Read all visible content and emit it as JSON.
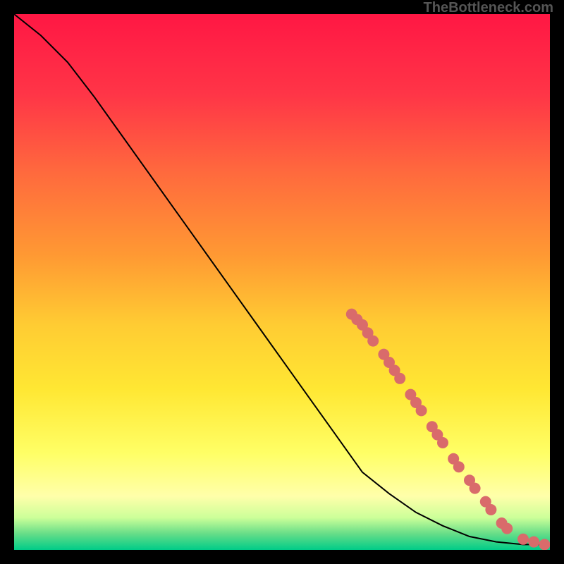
{
  "watermark": "TheBottleneck.com",
  "chart_data": {
    "type": "line",
    "title": "",
    "xlabel": "",
    "ylabel": "",
    "xlim": [
      0,
      100
    ],
    "ylim": [
      0,
      100
    ],
    "line_path": [
      {
        "x": 0,
        "y": 100
      },
      {
        "x": 5,
        "y": 96
      },
      {
        "x": 10,
        "y": 91
      },
      {
        "x": 15,
        "y": 84.5
      },
      {
        "x": 20,
        "y": 77.5
      },
      {
        "x": 25,
        "y": 70.5
      },
      {
        "x": 30,
        "y": 63.5
      },
      {
        "x": 35,
        "y": 56.5
      },
      {
        "x": 40,
        "y": 49.5
      },
      {
        "x": 45,
        "y": 42.5
      },
      {
        "x": 50,
        "y": 35.5
      },
      {
        "x": 55,
        "y": 28.5
      },
      {
        "x": 60,
        "y": 21.5
      },
      {
        "x": 65,
        "y": 14.5
      },
      {
        "x": 70,
        "y": 10.5
      },
      {
        "x": 75,
        "y": 7
      },
      {
        "x": 80,
        "y": 4.5
      },
      {
        "x": 85,
        "y": 2.5
      },
      {
        "x": 90,
        "y": 1.5
      },
      {
        "x": 95,
        "y": 1
      },
      {
        "x": 100,
        "y": 1
      }
    ],
    "scatter_points": [
      {
        "x": 63,
        "y": 44
      },
      {
        "x": 64,
        "y": 43
      },
      {
        "x": 65,
        "y": 42
      },
      {
        "x": 66,
        "y": 40.5
      },
      {
        "x": 67,
        "y": 39
      },
      {
        "x": 69,
        "y": 36.5
      },
      {
        "x": 70,
        "y": 35
      },
      {
        "x": 71,
        "y": 33.5
      },
      {
        "x": 72,
        "y": 32
      },
      {
        "x": 74,
        "y": 29
      },
      {
        "x": 75,
        "y": 27.5
      },
      {
        "x": 76,
        "y": 26
      },
      {
        "x": 78,
        "y": 23
      },
      {
        "x": 79,
        "y": 21.5
      },
      {
        "x": 80,
        "y": 20
      },
      {
        "x": 82,
        "y": 17
      },
      {
        "x": 83,
        "y": 15.5
      },
      {
        "x": 85,
        "y": 13
      },
      {
        "x": 86,
        "y": 11.5
      },
      {
        "x": 88,
        "y": 9
      },
      {
        "x": 89,
        "y": 7.5
      },
      {
        "x": 91,
        "y": 5
      },
      {
        "x": 92,
        "y": 4
      },
      {
        "x": 95,
        "y": 2
      },
      {
        "x": 97,
        "y": 1.5
      },
      {
        "x": 99,
        "y": 1
      }
    ],
    "gradient_stops": [
      {
        "offset": 0,
        "color": "#ff1744"
      },
      {
        "offset": 15,
        "color": "#ff3547"
      },
      {
        "offset": 30,
        "color": "#ff6b3d"
      },
      {
        "offset": 45,
        "color": "#ff9933"
      },
      {
        "offset": 58,
        "color": "#ffcc33"
      },
      {
        "offset": 70,
        "color": "#ffe733"
      },
      {
        "offset": 82,
        "color": "#ffff66"
      },
      {
        "offset": 90,
        "color": "#ffffaa"
      },
      {
        "offset": 94,
        "color": "#ccff99"
      },
      {
        "offset": 97,
        "color": "#66dd88"
      },
      {
        "offset": 100,
        "color": "#00cc88"
      }
    ],
    "marker_color": "#d96b6b",
    "line_color": "#000000"
  }
}
